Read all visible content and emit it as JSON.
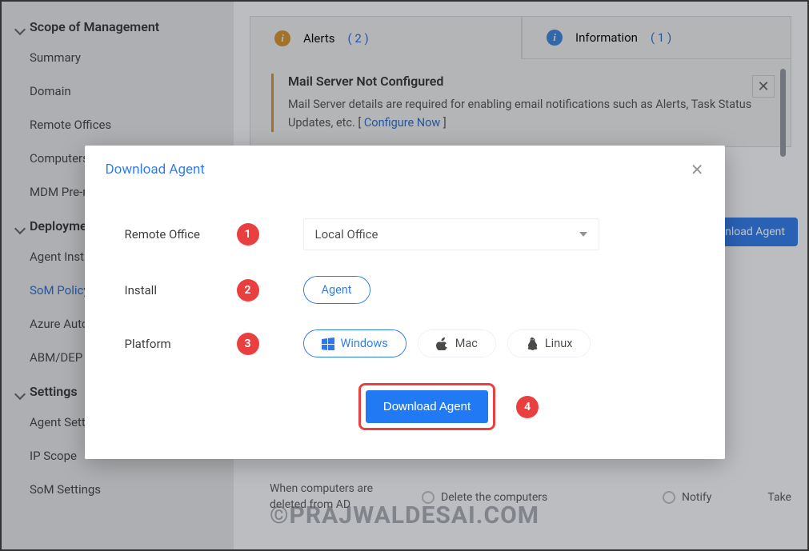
{
  "sidebar": {
    "sections": [
      {
        "title": "Scope of Management",
        "items": [
          "Summary",
          "Domain",
          "Remote Offices",
          "Computers",
          "MDM Pre-requisites"
        ]
      },
      {
        "title": "Deployment",
        "items": [
          "Agent Installation",
          "SoM Policy",
          "Azure Auto-Sync",
          "ABM/DEP"
        ]
      },
      {
        "title": "Settings",
        "items": [
          "Agent Settings",
          "IP Scope",
          "SoM Settings"
        ]
      }
    ],
    "active_item": "SoM Policy"
  },
  "tabs": {
    "alerts_label": "Alerts",
    "alerts_count": "( 2 )",
    "info_label": "Information",
    "info_count": "( 1 )"
  },
  "alert": {
    "title": "Mail Server Not Configured",
    "text_pre": "Mail Server details are required for enabling email notifications such as Alerts, Task Status Updates, etc. [ ",
    "link": "Configure Now",
    "text_post": " ]"
  },
  "download_button_bg": "Download Agent",
  "policy": {
    "label": "When computers are deleted from AD",
    "opt_delete": "Delete the computers",
    "opt_notify": "Notify",
    "opt_take": "Take"
  },
  "modal": {
    "title": "Download Agent",
    "rows": {
      "remote_office": {
        "label": "Remote Office",
        "badge": "1",
        "value": "Local Office"
      },
      "install": {
        "label": "Install",
        "badge": "2",
        "value": "Agent"
      },
      "platform": {
        "label": "Platform",
        "badge": "3",
        "options": {
          "win": "Windows",
          "mac": "Mac",
          "linux": "Linux"
        }
      }
    },
    "submit": {
      "label": "Download Agent",
      "badge": "4"
    }
  },
  "watermark": "©PRAJWALDESAI.COM"
}
